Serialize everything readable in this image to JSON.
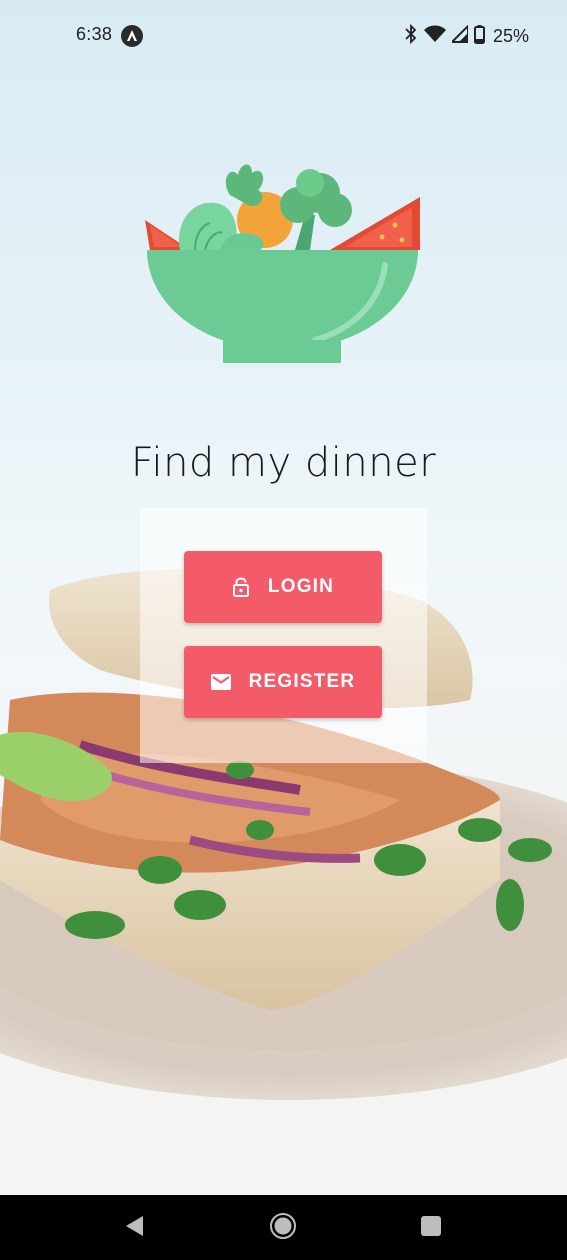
{
  "status_bar": {
    "time": "6:38",
    "battery": "25%",
    "icons": [
      "app-notification-icon",
      "bluetooth-icon",
      "wifi-icon",
      "cellular-signal-icon",
      "battery-icon"
    ]
  },
  "app": {
    "title": "Find my dinner",
    "logo": "salad-bowl-logo"
  },
  "actions": {
    "login_label": "LOGIN",
    "login_icon": "lock-icon",
    "register_label": "REGISTER",
    "register_icon": "mail-icon"
  },
  "navigation": {
    "back": "back-icon",
    "home": "home-icon",
    "recents": "recents-icon"
  },
  "colors": {
    "accent": "#f45b69",
    "bowl": "#6ccb94",
    "background": "#eef5f8",
    "nav_bar": "#000000"
  }
}
